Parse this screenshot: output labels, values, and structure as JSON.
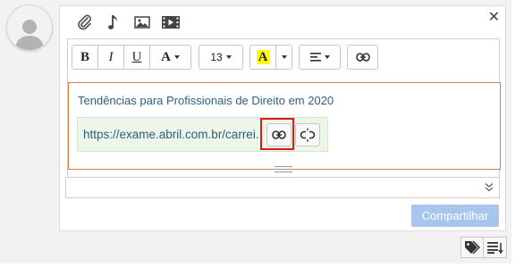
{
  "composer": {
    "toolbar": {
      "bold_label": "B",
      "italic_label": "I",
      "underline_label": "U",
      "font_color_label": "A",
      "font_size_value": "13",
      "highlight_label": "A"
    },
    "content": {
      "link_text": "Tendências para Profissionais de Direito em 2020",
      "link_url_preview": "https://exame.abril.com.br/carrei..."
    },
    "share_button_label": "Compartilhar"
  },
  "colors": {
    "highlight_yellow": "#ffff00",
    "share_button_bg": "#a8c6ec",
    "focus_border": "#e07a3a",
    "link_color": "#2b5f85",
    "annotation_red": "#e01919"
  },
  "icons": {
    "top": [
      "paperclip-icon",
      "music-note-icon",
      "image-icon",
      "video-icon"
    ],
    "close": "close-icon",
    "popover": [
      "link-icon",
      "unlink-icon"
    ],
    "bottom": [
      "tags-icon",
      "list-icon"
    ]
  }
}
